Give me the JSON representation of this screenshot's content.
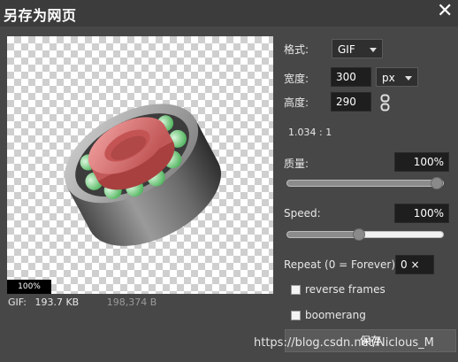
{
  "dialog": {
    "title": "另存为网页",
    "close_glyph": "✕"
  },
  "preview": {
    "zoom_label": "100%",
    "subject": "bearing-ring-image",
    "colors": {
      "outer_ring": "#8f8f8f",
      "inner_ring": "#e07474",
      "balls": "#86d98f"
    }
  },
  "fileinfo": {
    "format": "GIF:",
    "size": "193.7 KB",
    "bytes": "198,374 B"
  },
  "options": {
    "format_label": "格式:",
    "format_value": "GIF",
    "width_label": "宽度:",
    "width_value": "300",
    "unit_value": "px",
    "height_label": "高度:",
    "height_value": "290",
    "ratio": "1.034 : 1",
    "quality_label": "质量:",
    "quality_value": "100%",
    "quality_level": 1.0,
    "speed_label": "Speed:",
    "speed_value": "100%",
    "speed_level": 0.46,
    "repeat_label": "Repeat (0 = Forever):",
    "repeat_value": "0 ×",
    "reverse_label": "reverse frames",
    "reverse_checked": false,
    "boomerang_label": "boomerang",
    "boomerang_checked": false,
    "save_label": "保存"
  },
  "watermark": "https://blog.csdn.net/Niclous_M"
}
